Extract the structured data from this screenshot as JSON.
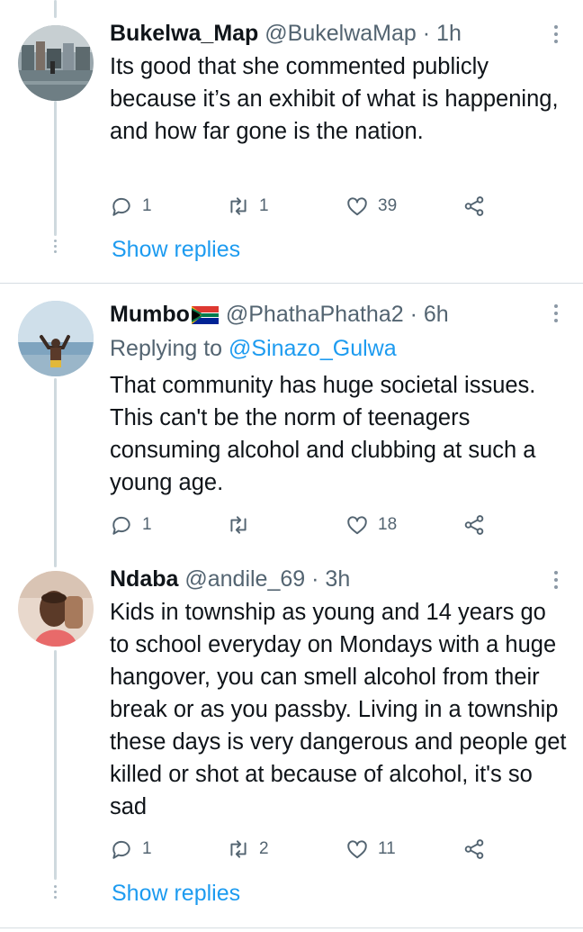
{
  "tweets": [
    {
      "name": "Bukelwa_Map",
      "handle": "@BukelwaMap",
      "sep": "·",
      "time": "1h",
      "text": "Its good that she commented publicly because it’s an exhibit of what is happening, and how far gone is the nation.",
      "replies": "1",
      "retweets": "1",
      "likes": "39",
      "show_replies": "Show replies"
    },
    {
      "name": "Mumbo",
      "flag_icon": "south-africa-flag-icon",
      "handle": "@PhathaPhatha2",
      "sep": "·",
      "time": "6h",
      "replying_prefix": "Replying to",
      "replying_to": "@Sinazo_Gulwa",
      "text": "That community has huge societal issues. This can't be the norm of teenagers consuming alcohol and clubbing at such a young age.",
      "replies": "1",
      "retweets": "",
      "likes": "18"
    },
    {
      "name": "Ndaba",
      "handle": "@andile_69",
      "sep": "·",
      "time": "3h",
      "text": "Kids in township as young and 14 years go to school everyday on Mondays with a huge hangover, you can smell alcohol from their break or as you passby. Living in a township these days is very dangerous and people get killed or shot at because of alcohol, it's so sad",
      "replies": "1",
      "retweets": "2",
      "likes": "11",
      "show_replies": "Show replies"
    }
  ],
  "colors": {
    "accent": "#1d9bf0",
    "secondary_text": "#536471",
    "thread_line": "#cfd9de"
  },
  "icons": [
    "reply-icon",
    "retweet-icon",
    "like-icon",
    "share-icon",
    "more-options-icon"
  ]
}
